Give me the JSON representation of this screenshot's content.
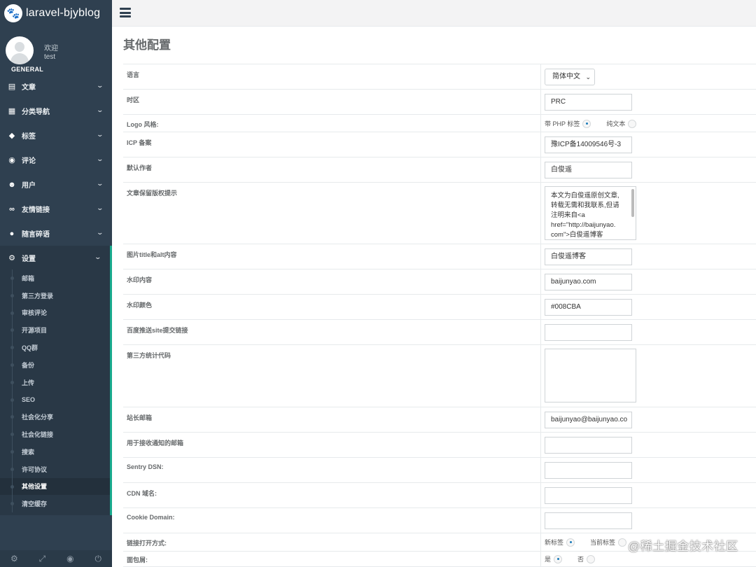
{
  "brand": {
    "name": "laravel-bjyblog",
    "icon": "paw-icon"
  },
  "profile": {
    "welcome": "欢迎",
    "username": "test",
    "role": "GENERAL"
  },
  "nav": [
    {
      "label": "文章",
      "icon": "book-icon"
    },
    {
      "label": "分类导航",
      "icon": "grid-icon"
    },
    {
      "label": "标签",
      "icon": "tags-icon"
    },
    {
      "label": "评论",
      "icon": "comments-icon"
    },
    {
      "label": "用户",
      "icon": "users-icon"
    },
    {
      "label": "友情链接",
      "icon": "link-icon"
    },
    {
      "label": "随言碎语",
      "icon": "comment-icon"
    },
    {
      "label": "设置",
      "icon": "cogs-icon"
    }
  ],
  "settings_menu": [
    "邮箱",
    "第三方登录",
    "审核评论",
    "开源项目",
    "QQ群",
    "备份",
    "上传",
    "SEO",
    "社会化分享",
    "社会化链接",
    "搜索",
    "许可协议",
    "其他设置",
    "清空缓存"
  ],
  "page": {
    "title": "其他配置"
  },
  "fields": {
    "language": {
      "label": "语言",
      "value": "简体中文"
    },
    "timezone": {
      "label": "时区",
      "value": "PRC"
    },
    "logo_style": {
      "label": "Logo 风格:",
      "opt1": "带 PHP 标签",
      "opt2": "纯文本"
    },
    "icp": {
      "label": "ICP 备案",
      "value": "豫ICP备14009546号-3"
    },
    "author": {
      "label": "默认作者",
      "value": "白俊遥"
    },
    "copyright": {
      "label": "文章保留版权提示",
      "lines": [
        "本文为白俊遥原创文章,",
        "转载无需和我联系,但请",
        "注明来自<a",
        "href=\"http://baijunyao.",
        "com\">白俊遥博客"
      ]
    },
    "img_alt": {
      "label": "图片title和alt内容",
      "value": "白俊遥博客"
    },
    "watermark_text": {
      "label": "水印内容",
      "value": "baijunyao.com"
    },
    "watermark_color": {
      "label": "水印颜色",
      "value": "#008CBA"
    },
    "baidu_push": {
      "label": "百度推送site提交链接",
      "value": ""
    },
    "stats_code": {
      "label": "第三方统计代码",
      "value": ""
    },
    "admin_email": {
      "label": "站长邮箱",
      "value": "baijunyao@baijunyao.co"
    },
    "notify_email": {
      "label": "用于接收通知的邮箱",
      "value": ""
    },
    "sentry": {
      "label": "Sentry DSN:",
      "value": ""
    },
    "cdn": {
      "label": "CDN 域名:",
      "value": ""
    },
    "cookie": {
      "label": "Cookie Domain:",
      "value": ""
    },
    "link_target": {
      "label": "链接打开方式:",
      "opt1": "新标签",
      "opt2": "当前标签"
    },
    "breadcrumb": {
      "label": "面包屑:",
      "opt1": "是",
      "opt2": "否"
    }
  },
  "footer_icons": [
    "gear-icon",
    "expand-icon",
    "eye-slash-icon",
    "power-icon"
  ],
  "watermark": "@稀土掘金技术社区"
}
